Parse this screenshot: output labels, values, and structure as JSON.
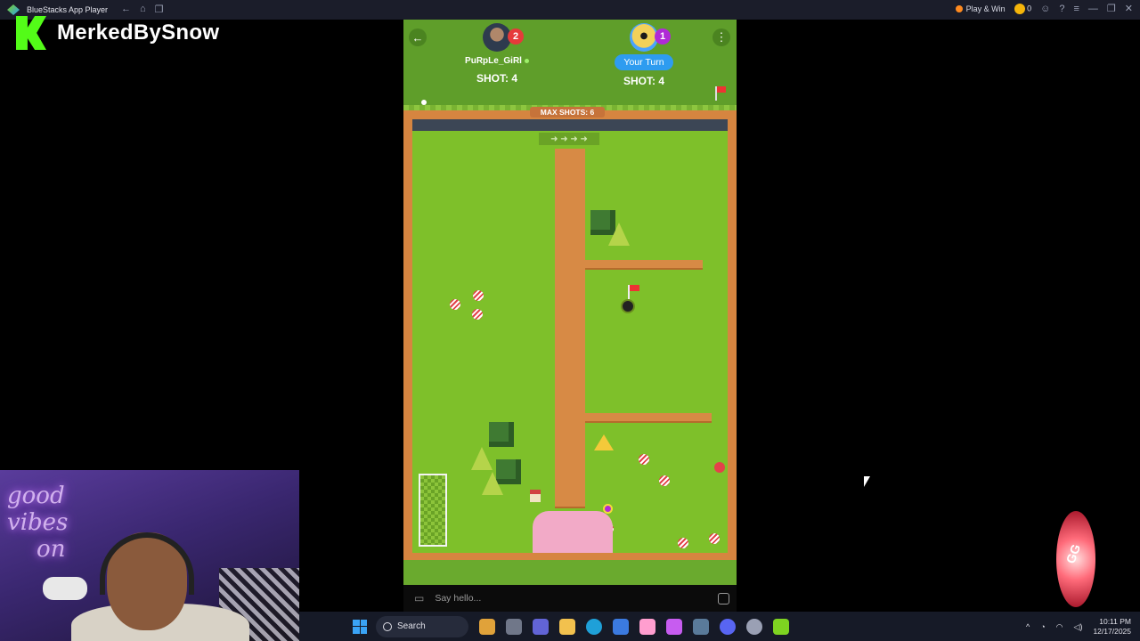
{
  "window": {
    "title": "BlueStacks App Player",
    "play_and_win": "Play & Win",
    "coin_count": "0"
  },
  "overlay": {
    "channel_name": "MerkedBySnow",
    "neon_sign": "good vibes on"
  },
  "game": {
    "players": [
      {
        "name": "PuRpLe_GiRl",
        "rank": "2",
        "shot_label": "SHOT: 4",
        "online": true
      },
      {
        "name": "Your Turn",
        "rank": "1",
        "shot_label": "SHOT: 4"
      }
    ],
    "max_shots_label": "MAX SHOTS: 6",
    "arrow_glyphs": "➜ ➜ ➜ ➜"
  },
  "chat": {
    "placeholder": "Say hello..."
  },
  "taskbar": {
    "search_label": "Search",
    "time": "10:11 PM",
    "date": "12/17/2025"
  },
  "colors": {
    "grass": "#7ec02a",
    "wall": "#d78a45",
    "your_turn": "#2e9cf0",
    "kick_green": "#53fc18"
  }
}
